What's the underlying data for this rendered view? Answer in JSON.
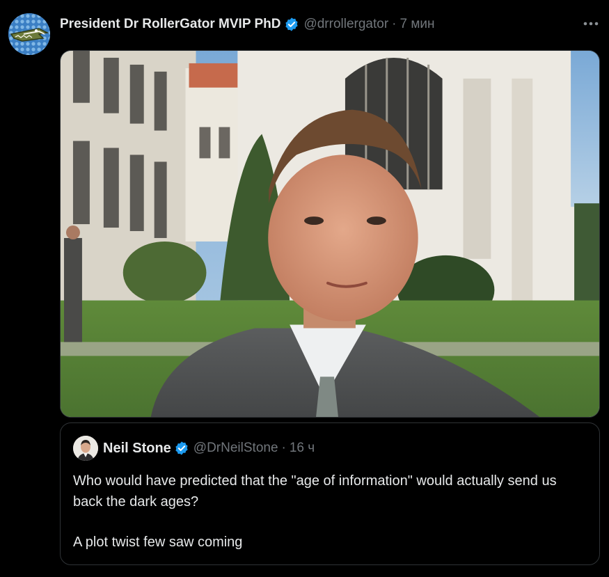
{
  "post": {
    "author_name": "President Dr RollerGator MVIP PhD",
    "handle": "@drrollergator",
    "separator": "·",
    "time": "7 мин",
    "verified": true,
    "more_icon": "more-horizontal-icon"
  },
  "media": {
    "alt": "photo"
  },
  "quote": {
    "author_name": "Neil Stone",
    "handle": "@DrNeilStone",
    "separator": "·",
    "time": "16 ч",
    "verified": true,
    "text_line1": "Who would have predicted that the \"age of information\" would actually send us back the dark ages?",
    "text_line2": "A plot twist few saw coming"
  },
  "colors": {
    "background": "#000000",
    "text_primary": "#e7e9ea",
    "text_secondary": "#71767b",
    "border": "#2f3336",
    "verified_blue": "#1d9bf0"
  }
}
